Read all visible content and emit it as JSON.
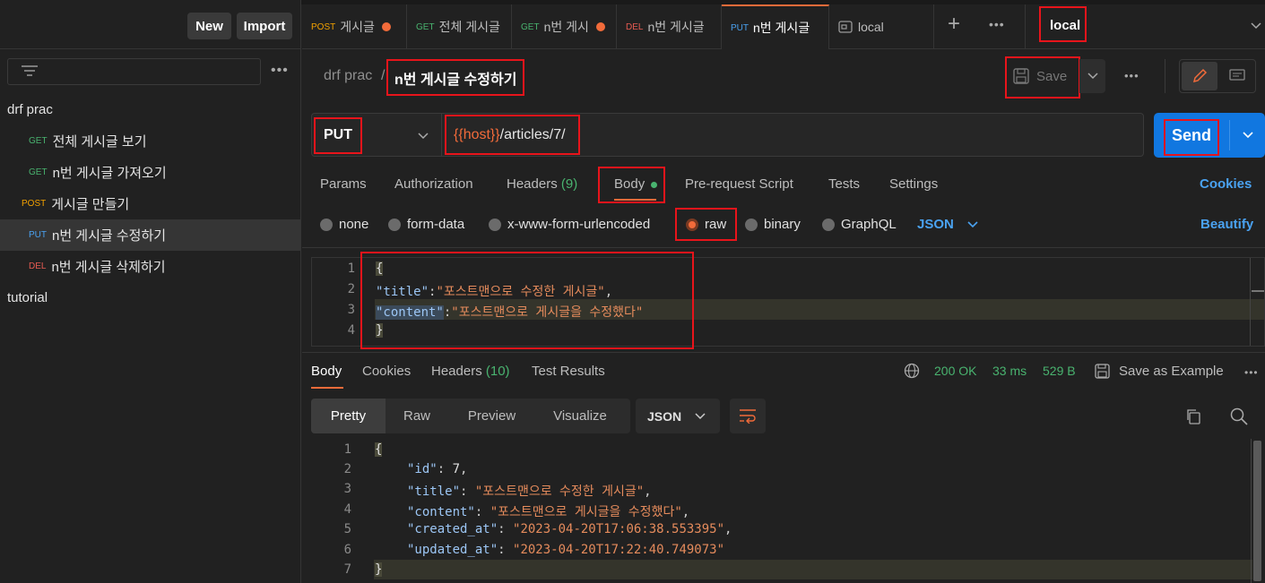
{
  "sidebar": {
    "new_label": "New",
    "import_label": "Import",
    "items": [
      {
        "method": "",
        "label": "drf prac"
      },
      {
        "method": "GET",
        "label": "전체 게시글 보기"
      },
      {
        "method": "GET",
        "label": "n번 게시글 가져오기"
      },
      {
        "method": "POST",
        "label": "게시글 만들기"
      },
      {
        "method": "PUT",
        "label": "n번 게시글 수정하기"
      },
      {
        "method": "DEL",
        "label": "n번 게시글 삭제하기"
      },
      {
        "method": "",
        "label": "tutorial"
      }
    ]
  },
  "tabs": [
    {
      "method": "POST",
      "label": "게시글"
    },
    {
      "method": "GET",
      "label": "전체 게시글"
    },
    {
      "method": "GET",
      "label": "n번 게시"
    },
    {
      "method": "DEL",
      "label": "n번 게시글"
    },
    {
      "method": "PUT",
      "label": "n번 게시글"
    },
    {
      "method": "",
      "label": "local"
    }
  ],
  "environment": "local",
  "breadcrumb": {
    "collection": "drf prac",
    "separator": "/",
    "request": "n번 게시글 수정하기"
  },
  "save_label": "Save",
  "request": {
    "method": "PUT",
    "url_var": "{{host}}",
    "url_path": "/articles/7/",
    "send_label": "Send"
  },
  "req_tabs": {
    "params": "Params",
    "authorization": "Authorization",
    "headers": "Headers",
    "headers_count": "(9)",
    "body": "Body",
    "prerequest": "Pre-request Script",
    "tests": "Tests",
    "settings": "Settings",
    "cookies": "Cookies"
  },
  "body_types": {
    "none": "none",
    "form_data": "form-data",
    "urlencoded": "x-www-form-urlencoded",
    "raw": "raw",
    "binary": "binary",
    "graphql": "GraphQL",
    "format": "JSON",
    "beautify": "Beautify"
  },
  "request_body": {
    "line_numbers": [
      "1",
      "2",
      "3",
      "4"
    ],
    "open_brace": "{",
    "title_key": "\"title\"",
    "title_value": "\"포스트맨으로 수정한 게시글\"",
    "content_key": "\"content\"",
    "content_value": "\"포스트맨으로 게시글을 수정했다\"",
    "close_brace": "}"
  },
  "response": {
    "tabs": {
      "body": "Body",
      "cookies": "Cookies",
      "headers": "Headers",
      "headers_count": "(10)",
      "test_results": "Test Results"
    },
    "status": "200 OK",
    "time": "33 ms",
    "size": "529 B",
    "save_example": "Save as Example",
    "views": {
      "pretty": "Pretty",
      "raw": "Raw",
      "preview": "Preview",
      "visualize": "Visualize",
      "format": "JSON"
    },
    "line_numbers": [
      "1",
      "2",
      "3",
      "4",
      "5",
      "6",
      "7"
    ],
    "open_brace": "{",
    "id_key": "\"id\"",
    "id_value": "7",
    "title_key": "\"title\"",
    "title_value": "\"포스트맨으로 수정한 게시글\"",
    "content_key": "\"content\"",
    "content_value": "\"포스트맨으로 게시글을 수정했다\"",
    "created_key": "\"created_at\"",
    "created_value": "\"2023-04-20T17:06:38.553395\"",
    "updated_key": "\"updated_at\"",
    "updated_value": "\"2023-04-20T17:22:40.749073\"",
    "close_brace": "}"
  },
  "colors": {
    "accent": "#f26b3a",
    "send_blue": "#1177e0",
    "get": "#49b36f",
    "post": "#f2a100",
    "put": "#4aa2f0",
    "del": "#e85b52",
    "annotation_red": "#e8141b"
  }
}
